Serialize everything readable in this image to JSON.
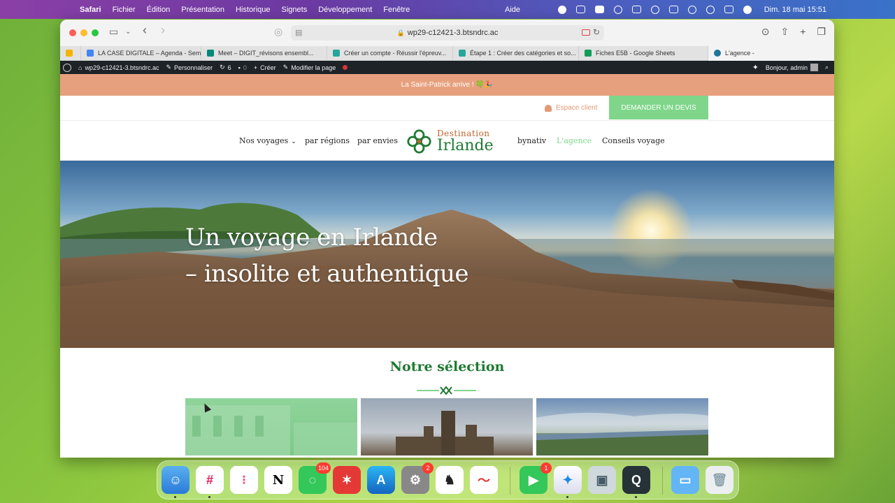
{
  "menubar": {
    "app": "Safari",
    "items": [
      "Fichier",
      "Édition",
      "Présentation",
      "Historique",
      "Signets",
      "Développement",
      "Fenêtre"
    ],
    "help": "Aide",
    "clock": "Dim. 18 mai  15:51"
  },
  "browser": {
    "url": "wp29-c12421-3.btsndrc.ac",
    "tabs": [
      {
        "label": "",
        "icon": "drive-icon",
        "color": "#f4b400"
      },
      {
        "label": "LA CASE DIGITALE – Agenda - Sem...",
        "icon": "calendar-icon",
        "color": "#4285f4"
      },
      {
        "label": "Meet – DIGIT_révisons ensembl...",
        "icon": "meet-icon",
        "color": "#00897b"
      },
      {
        "label": "Créer un compte - Réussir l'épreuv...",
        "icon": "site-icon",
        "color": "#26a69a"
      },
      {
        "label": "Étape 1 : Créer des catégories et so...",
        "icon": "site-icon",
        "color": "#26a69a"
      },
      {
        "label": "Fiches E5B - Google Sheets",
        "icon": "sheets-icon",
        "color": "#0f9d58"
      },
      {
        "label": "L'agence -",
        "icon": "wordpress-icon",
        "color": "#21759b"
      }
    ]
  },
  "adminbar": {
    "site": "wp29-c12421-3.btsndrc.ac",
    "customize": "Personnaliser",
    "updates": "6",
    "comments": "0",
    "new": "Créer",
    "edit": "Modifier la page",
    "greeting": "Bonjour, admin"
  },
  "site": {
    "promo": "La Saint-Patrick arrive ! 🍀🎉",
    "espace_client": "Espace client",
    "cta": "DEMANDER UN DEVIS",
    "nav": [
      "Nos voyages",
      "par régions",
      "par envies",
      "bynativ",
      "L'agence",
      "Conseils voyage"
    ],
    "logo_top": "Destination",
    "logo_bottom": "Irlande",
    "hero_line1": "Un voyage en Irlande",
    "hero_line2": "– insolite et authentique",
    "section_title": "Notre sélection"
  },
  "dock": {
    "badges": {
      "messages": "104",
      "settings": "2",
      "facetime": "1"
    }
  },
  "colors": {
    "promo": "#e7a07e",
    "cta": "#7fd68a",
    "brand_green": "#1f7a32",
    "brand_orange": "#c0622b",
    "admin_bar": "#1d2327"
  }
}
